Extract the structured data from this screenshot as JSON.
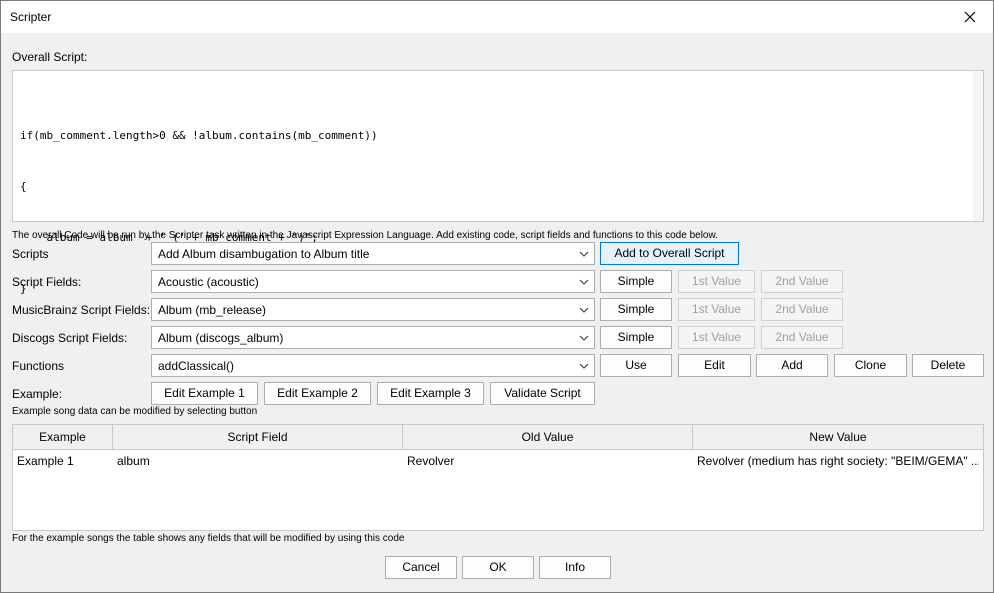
{
  "window": {
    "title": "Scripter"
  },
  "overall_script_label": "Overall Script:",
  "script_lines": [
    "if(mb_comment.length>0 && !album.contains(mb_comment))",
    "{",
    "    album = album  + ' (' + mb_comment + \")\";",
    "}"
  ],
  "overall_note": "The overall Code will be run by the Scripter task written in the Javascript Expression Language. Add existing code, script fields and functions to this code below.",
  "rows": {
    "scripts": {
      "label": "Scripts",
      "value": "Add Album disambugation to Album title",
      "button": "Add to Overall Script"
    },
    "script_fields": {
      "label": "Script Fields:",
      "value": "Acoustic (acoustic)"
    },
    "mb_fields": {
      "label": "MusicBrainz Script Fields:",
      "value": "Album (mb_release)"
    },
    "discogs_fields": {
      "label": "Discogs Script Fields:",
      "value": "Album (discogs_album)"
    },
    "functions": {
      "label": "Functions",
      "value": "addClassical()"
    }
  },
  "field_buttons": {
    "simple": "Simple",
    "first": "1st Value",
    "second": "2nd Value"
  },
  "function_buttons": {
    "use": "Use",
    "edit": "Edit",
    "add": "Add",
    "clone": "Clone",
    "delete": "Delete"
  },
  "example": {
    "label": "Example:",
    "buttons": [
      "Edit Example 1",
      "Edit Example 2",
      "Edit Example 3",
      "Validate Script"
    ],
    "note": "Example song data can be modified by selecting button"
  },
  "table": {
    "headers": [
      "Example",
      "Script Field",
      "Old Value",
      "New Value"
    ],
    "rows": [
      [
        "Example 1",
        "album",
        "Revolver",
        "Revolver (medium has right society: \"BEIM/GEMA\" ..."
      ]
    ]
  },
  "table_note": "For the example songs the table shows any fields that will be modified by using this code",
  "footer": {
    "cancel": "Cancel",
    "ok": "OK",
    "info": "Info"
  },
  "colors": {
    "accent": "#0078d7",
    "dialog_bg": "#f0f0f0"
  }
}
